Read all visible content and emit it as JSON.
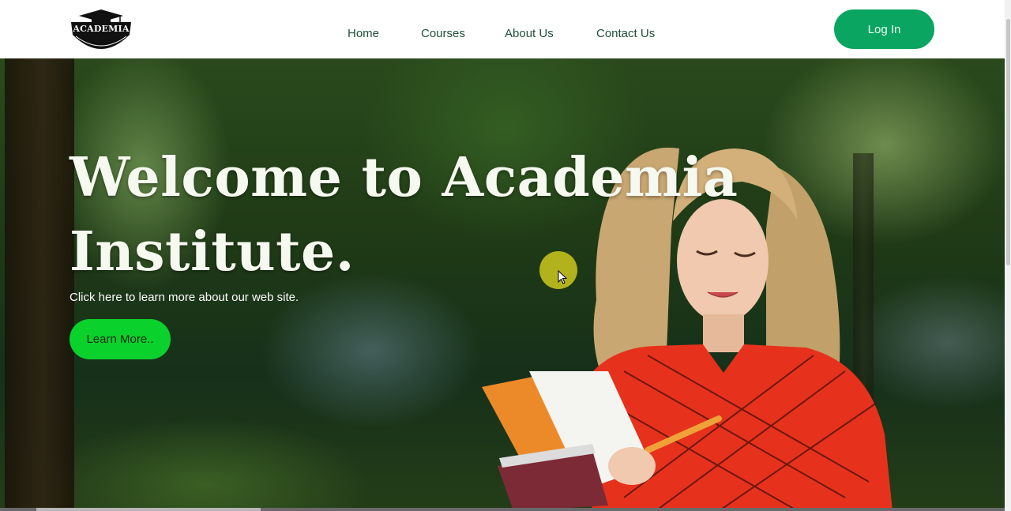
{
  "brand": {
    "logo_text": "ACADEMIA",
    "colors": {
      "primary": "#0aa560",
      "accent": "#0bd12c",
      "nav_text": "#1f4f3a"
    }
  },
  "nav": {
    "links": [
      {
        "label": "Home"
      },
      {
        "label": "Courses"
      },
      {
        "label": "About Us"
      },
      {
        "label": "Contact Us"
      }
    ],
    "login_label": "Log In"
  },
  "hero": {
    "title": "Welcome to Academia Institute.",
    "subtitle": "Click here to learn more about our web site.",
    "cta_label": "Learn More.."
  }
}
